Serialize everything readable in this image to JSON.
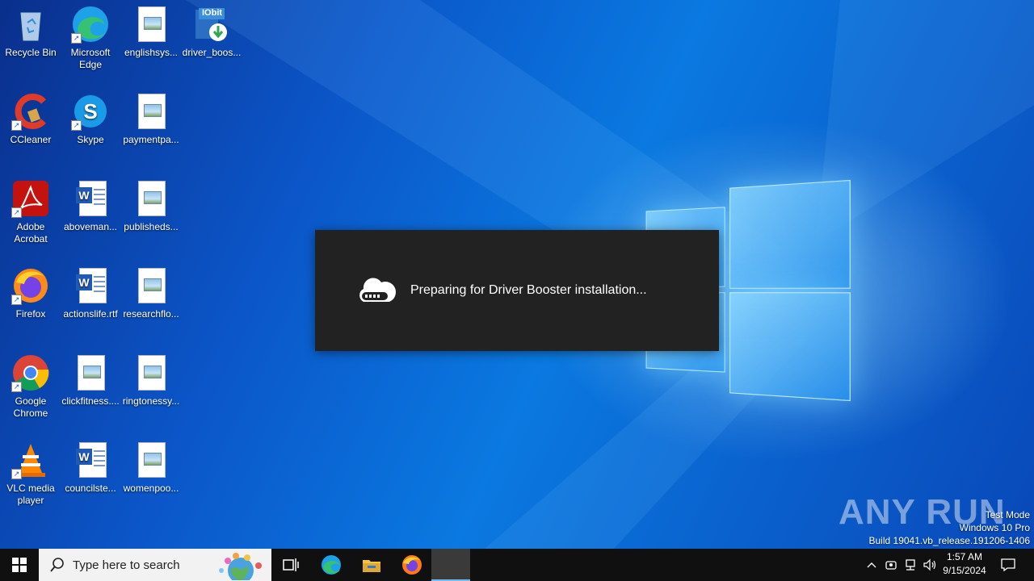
{
  "desktop_icons": [
    {
      "label": "Recycle Bin",
      "icon": "recycle-bin-icon"
    },
    {
      "label": "Microsoft Edge",
      "icon": "edge-icon"
    },
    {
      "label": "englishsys...",
      "icon": "image-file-icon"
    },
    {
      "label": "driver_boos...",
      "icon": "iobit-installer-icon",
      "badge": "IObit"
    },
    {
      "label": "CCleaner",
      "icon": "ccleaner-icon"
    },
    {
      "label": "Skype",
      "icon": "skype-icon"
    },
    {
      "label": "paymentpa...",
      "icon": "image-file-icon"
    },
    {
      "label": "Adobe Acrobat",
      "icon": "acrobat-icon"
    },
    {
      "label": "aboveman...",
      "icon": "word-doc-icon"
    },
    {
      "label": "publisheds...",
      "icon": "image-file-icon"
    },
    {
      "label": "Firefox",
      "icon": "firefox-icon"
    },
    {
      "label": "actionslife.rtf",
      "icon": "word-doc-icon"
    },
    {
      "label": "researchflo...",
      "icon": "image-file-icon"
    },
    {
      "label": "Google Chrome",
      "icon": "chrome-icon"
    },
    {
      "label": "clickfitness....",
      "icon": "image-file-icon"
    },
    {
      "label": "ringtonessy...",
      "icon": "image-file-icon"
    },
    {
      "label": "VLC media player",
      "icon": "vlc-icon"
    },
    {
      "label": "councilste...",
      "icon": "word-doc-icon"
    },
    {
      "label": "womenpoo...",
      "icon": "image-file-icon"
    }
  ],
  "dialog": {
    "message": "Preparing for Driver Booster installation...",
    "icon": "cloud-progress-icon"
  },
  "watermark": {
    "line1": "Test Mode",
    "line2": "Windows 10 Pro",
    "line3": "Build 19041.vb_release.191206-1406",
    "brand": "ANY RUN"
  },
  "taskbar": {
    "search_placeholder": "Type here to search",
    "pinned": [
      "task-view-icon",
      "edge-icon",
      "file-explorer-icon",
      "firefox-icon"
    ],
    "tray_icons": [
      "chevron-up-icon",
      "meet-now-icon",
      "network-icon",
      "volume-icon"
    ],
    "time": "1:57 AM",
    "date": "9/15/2024"
  },
  "colors": {
    "desktop_blue": "#0a79e0",
    "taskbar": "#101010",
    "dialog_bg": "#222222"
  }
}
